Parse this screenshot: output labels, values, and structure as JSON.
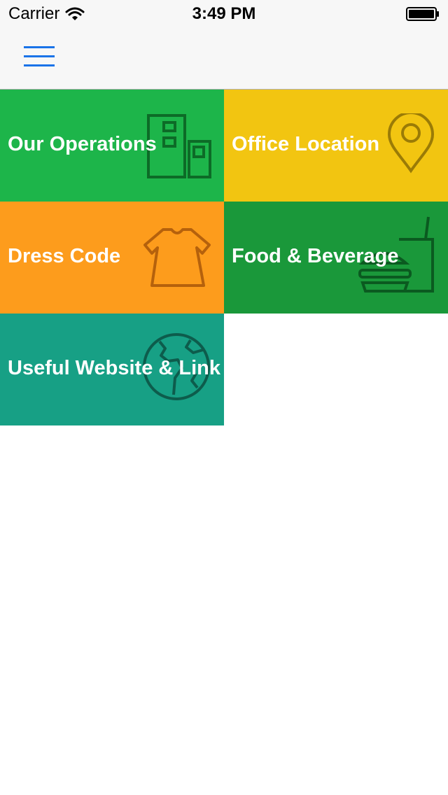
{
  "status_bar": {
    "carrier": "Carrier",
    "time": "3:49 PM",
    "wifi_icon": "wifi-icon",
    "battery_icon": "battery-icon"
  },
  "nav": {
    "menu_icon": "hamburger-menu-icon",
    "accent_color": "#1a73e8"
  },
  "tiles": [
    {
      "label": "Our Operations",
      "icon": "buildings-icon",
      "color": "#1db54a"
    },
    {
      "label": "Office Location",
      "icon": "map-pin-icon",
      "color": "#f2c511"
    },
    {
      "label": "Dress Code",
      "icon": "shirt-icon",
      "color": "#fd9c1c"
    },
    {
      "label": "Food & Beverage",
      "icon": "burger-drink-icon",
      "color": "#1a983a"
    },
    {
      "label": "Useful Website & Link",
      "icon": "globe-icon",
      "color": "#17a085"
    }
  ]
}
